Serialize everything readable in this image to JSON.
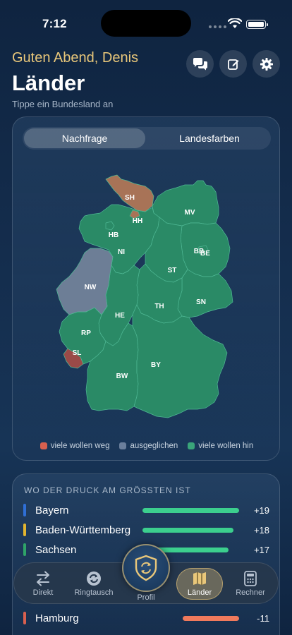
{
  "status": {
    "time": "7:12"
  },
  "header": {
    "greeting": "Guten Abend, Denis",
    "title": "Länder",
    "subtitle": "Tippe ein Bundesland an",
    "buttons": [
      {
        "icon": "chat-bubbles-icon"
      },
      {
        "icon": "edit-icon"
      },
      {
        "icon": "gear-icon"
      }
    ]
  },
  "map_card": {
    "tabs": [
      "Nachfrage",
      "Landesfarben"
    ],
    "active_tab": "Nachfrage",
    "states": {
      "SH": "SH",
      "HH": "HH",
      "MV": "MV",
      "HB": "HB",
      "NI": "NI",
      "BB": "BB",
      "BE": "BE",
      "ST": "ST",
      "NW": "NW",
      "HE": "HE",
      "TH": "TH",
      "SN": "SN",
      "RP": "RP",
      "SL": "SL",
      "BW": "BW",
      "BY": "BY"
    },
    "legend": [
      {
        "label": "viele wollen weg",
        "color": "#d8604f"
      },
      {
        "label": "ausgeglichen",
        "color": "#6b7f9c"
      },
      {
        "label": "viele wollen hin",
        "color": "#3aa57a"
      }
    ],
    "colors": {
      "green": "#2a8a66",
      "brown": "#a87357",
      "gray": "#6d7e96",
      "red": "#9a4a48"
    }
  },
  "pressure": {
    "title": "WO DER DRUCK AM GRÖSSTEN IST",
    "rows": [
      {
        "name": "Bayern",
        "value": "+19",
        "stripe": "#2f6fd6",
        "bar": "#3ccf8e"
      },
      {
        "name": "Baden-Württemberg",
        "value": "+18",
        "stripe": "#e3b52f",
        "bar": "#3ccf8e"
      },
      {
        "name": "Sachsen",
        "value": "+17",
        "stripe": "#2fa368",
        "bar": "#3ccf8e"
      },
      {
        "name": "Hamburg",
        "value": "-11",
        "stripe": "#d8604f",
        "bar": "#f07a5c"
      }
    ]
  },
  "tabbar": {
    "tabs": [
      {
        "label": "Direkt",
        "icon": "arrows-swap-icon"
      },
      {
        "label": "Ringtausch",
        "icon": "cycle-icon"
      },
      {
        "label": "Profil",
        "icon": "shield-icon"
      },
      {
        "label": "Länder",
        "icon": "map-icon"
      },
      {
        "label": "Rechner",
        "icon": "calculator-icon"
      }
    ],
    "active": "Länder"
  }
}
